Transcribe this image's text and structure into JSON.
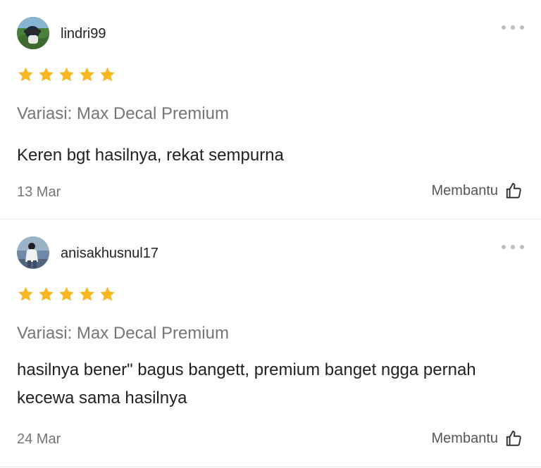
{
  "reviews": [
    {
      "username": "lindri99",
      "rating": 5,
      "variant": "Variasi: Max Decal Premium",
      "comment": "Keren bgt hasilnya, rekat sempurna",
      "date": "13 Mar",
      "helpful_label": "Membantu"
    },
    {
      "username": "anisakhusnul17",
      "rating": 5,
      "variant": "Variasi: Max Decal Premium",
      "comment": "hasilnya bener\" bagus bangett, premium banget ngga pernah kecewa sama hasilnya",
      "date": "24 Mar",
      "helpful_label": "Membantu"
    }
  ],
  "colors": {
    "star": "#f8b620",
    "muted_text": "#757575",
    "primary_text": "#222222",
    "divider": "#ececec"
  },
  "icons": {
    "rating": "star-icon",
    "options": "more-options-icon",
    "helpful": "thumbs-up-icon"
  }
}
